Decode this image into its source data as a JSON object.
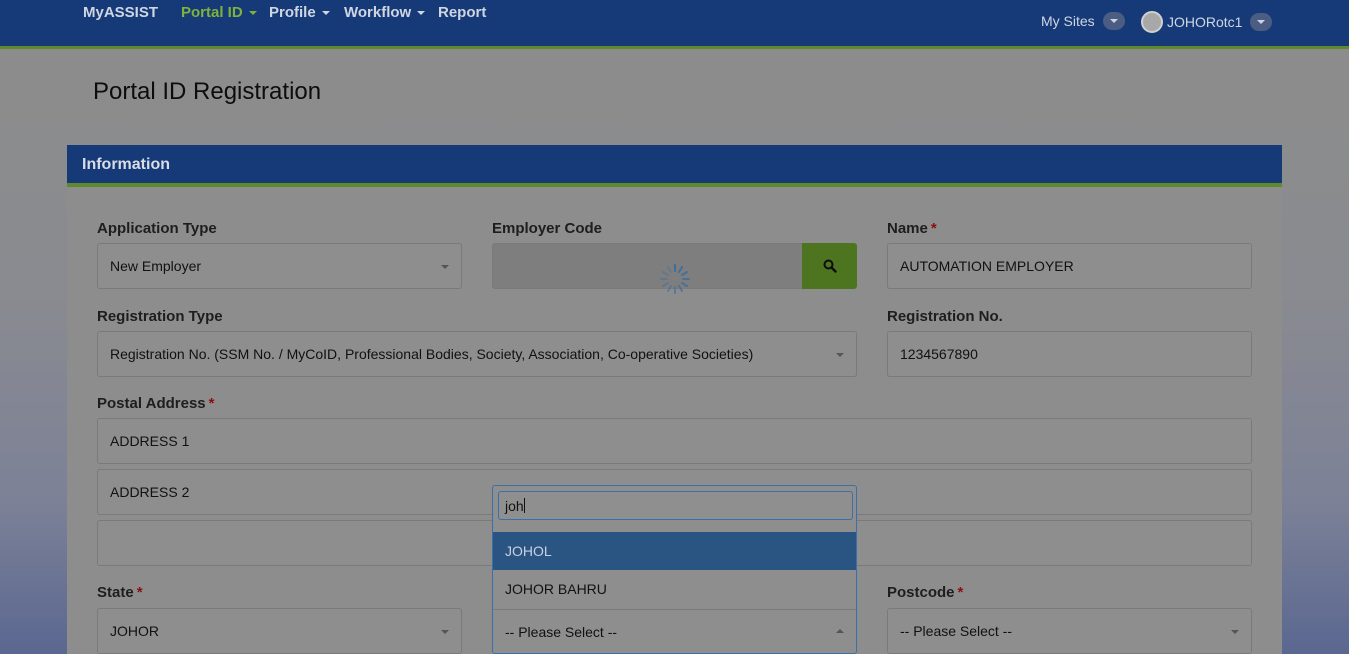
{
  "nav": {
    "brand": "MyASSIST",
    "items": [
      {
        "label": "Portal ID",
        "active": true,
        "has_caret": true
      },
      {
        "label": "Profile",
        "has_caret": true
      },
      {
        "label": "Workflow",
        "has_caret": true
      },
      {
        "label": "Report",
        "has_caret": false
      }
    ],
    "my_sites": "My Sites",
    "user": "JOHORotc1"
  },
  "page": {
    "title": "Portal ID Registration"
  },
  "panel": {
    "header": "Information"
  },
  "form": {
    "application_type": {
      "label": "Application Type",
      "value": "New Employer"
    },
    "employer_code": {
      "label": "Employer Code",
      "value": ""
    },
    "name": {
      "label": "Name",
      "required_mark": "*",
      "value": "AUTOMATION EMPLOYER"
    },
    "registration_type": {
      "label": "Registration Type",
      "value": "Registration No. (SSM No. / MyCoID, Professional Bodies, Society, Association, Co-operative Societies)"
    },
    "registration_no": {
      "label": "Registration No.",
      "value": "1234567890"
    },
    "postal_address": {
      "label": "Postal Address",
      "required_mark": "*",
      "line1": "ADDRESS 1",
      "line2": "ADDRESS 2",
      "line3": ""
    },
    "state": {
      "label": "State",
      "required_mark": "*",
      "value": "JOHOR"
    },
    "city": {
      "search_value": "joh",
      "options": [
        "JOHOL",
        "JOHOR BAHRU"
      ],
      "selected_display": "-- Please Select --"
    },
    "postcode": {
      "label": "Postcode",
      "required_mark": "*",
      "value": "-- Please Select --"
    }
  },
  "colors": {
    "navbar": "#163a78",
    "accent_green": "#5f8a2c",
    "highlight": "#2a5481",
    "required": "#8a0f0f"
  }
}
